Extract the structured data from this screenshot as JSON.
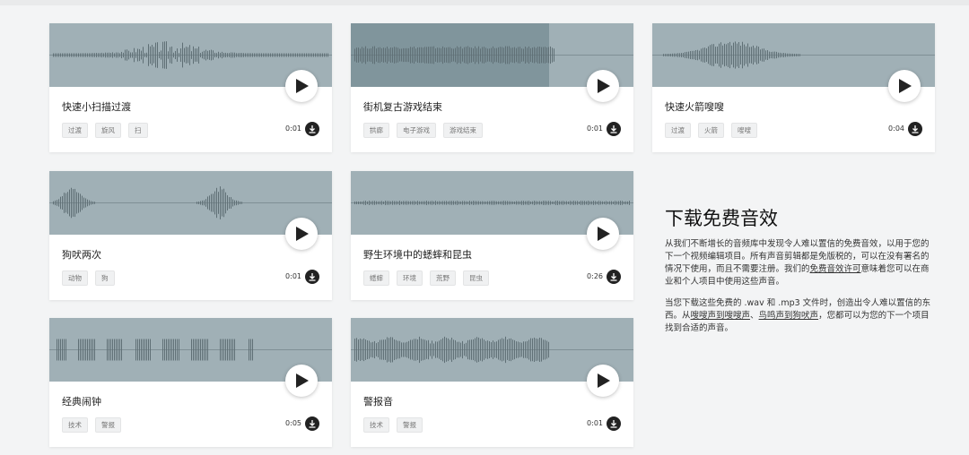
{
  "cards": [
    {
      "title": "快速小扫描过渡",
      "tags": [
        "过渡",
        "旋风",
        "扫"
      ],
      "duration": "0:01",
      "wave_style": "sparse",
      "progress": 0
    },
    {
      "title": "街机复古游戏结束",
      "tags": [
        "拱廊",
        "电子游戏",
        "游戏结束"
      ],
      "duration": "0:01",
      "wave_style": "dense-left",
      "progress": 0.7
    },
    {
      "title": "快速火箭嗖嗖",
      "tags": [
        "过渡",
        "火箭",
        "嗖嗖"
      ],
      "duration": "0:04",
      "wave_style": "center-burst",
      "progress": 0
    },
    {
      "title": "狗吠两次",
      "tags": [
        "动物",
        "狗"
      ],
      "duration": "0:01",
      "wave_style": "two-bursts",
      "progress": 0
    },
    {
      "title": "野生环境中的蟋蟀和昆虫",
      "tags": [
        "蟋蟀",
        "环境",
        "荒野",
        "昆虫"
      ],
      "duration": "0:26",
      "wave_style": "flat",
      "progress": 0
    },
    {
      "title": "经典闹钟",
      "tags": [
        "技术",
        "警报"
      ],
      "duration": "0:05",
      "wave_style": "blocks",
      "progress": 0
    },
    {
      "title": "警报音",
      "tags": [
        "技术",
        "警报"
      ],
      "duration": "0:01",
      "wave_style": "wavy",
      "progress": 0
    }
  ],
  "info": {
    "heading": "下载免费音效",
    "p1_a": "从我们不断增长的音频库中发现令人难以置信的免费音效，以用于您的下一个视频编辑项目。所有声音剪辑都是免版税的，可以在没有署名的情况下使用，而且不需要注册。我们的",
    "p1_link": "免费音效许可",
    "p1_b": "意味着您可以在商业和个人项目中使用这些声音。",
    "p2_a": "当您下载这些免费的 .wav 和 .mp3 文件时，创造出令人难以置信的东西。从",
    "p2_link1": "嗖嗖声到嗖嗖声",
    "p2_sep": "、",
    "p2_link2": "鸟鸣声到狗吠声",
    "p2_b": "，您都可以为您的下一个项目找到合适的声音。"
  },
  "colors": {
    "wave_bg": "#a0b0b6",
    "wave_played": "#80959c",
    "wave_line": "#5f6f75"
  },
  "icons": {
    "play": "play-icon",
    "download": "download-icon"
  }
}
